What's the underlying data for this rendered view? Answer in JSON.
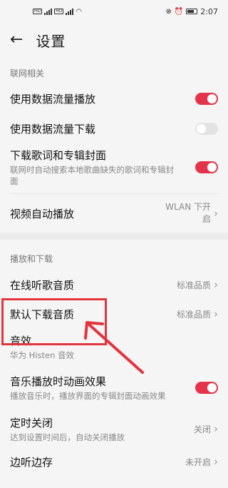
{
  "status": {
    "time": "2:07"
  },
  "header": {
    "title": "设置"
  },
  "sections": {
    "network": {
      "label": "联网相关",
      "items": [
        {
          "title": "使用数据流量播放",
          "toggle": "on"
        },
        {
          "title": "使用数据流量下载",
          "toggle": "off"
        },
        {
          "title": "下载歌词和专辑封面",
          "subtitle": "联网时自动搜索本地歌曲缺失的歌词和专辑封面",
          "toggle": "on"
        },
        {
          "title": "视频自动播放",
          "value": "WLAN 下开启"
        }
      ]
    },
    "playback": {
      "label": "播放和下载",
      "items": [
        {
          "title": "在线听歌音质",
          "value": "标准品质"
        },
        {
          "title": "默认下载音质",
          "value": "标准品质"
        },
        {
          "title": "音效",
          "subtitle": "华为 Histen 音效"
        },
        {
          "title": "音乐播放时动画效果",
          "subtitle": "播放音乐时，播放界面的专辑封面动画效果",
          "toggle": "on"
        },
        {
          "title": "定时关闭",
          "subtitle": "达到设置时间后，自动关闭播放",
          "value": "关闭"
        },
        {
          "title": "边听边存",
          "value": "未开启"
        }
      ]
    }
  },
  "colors": {
    "accent": "#e5334b",
    "annotation": "#e3343d"
  }
}
